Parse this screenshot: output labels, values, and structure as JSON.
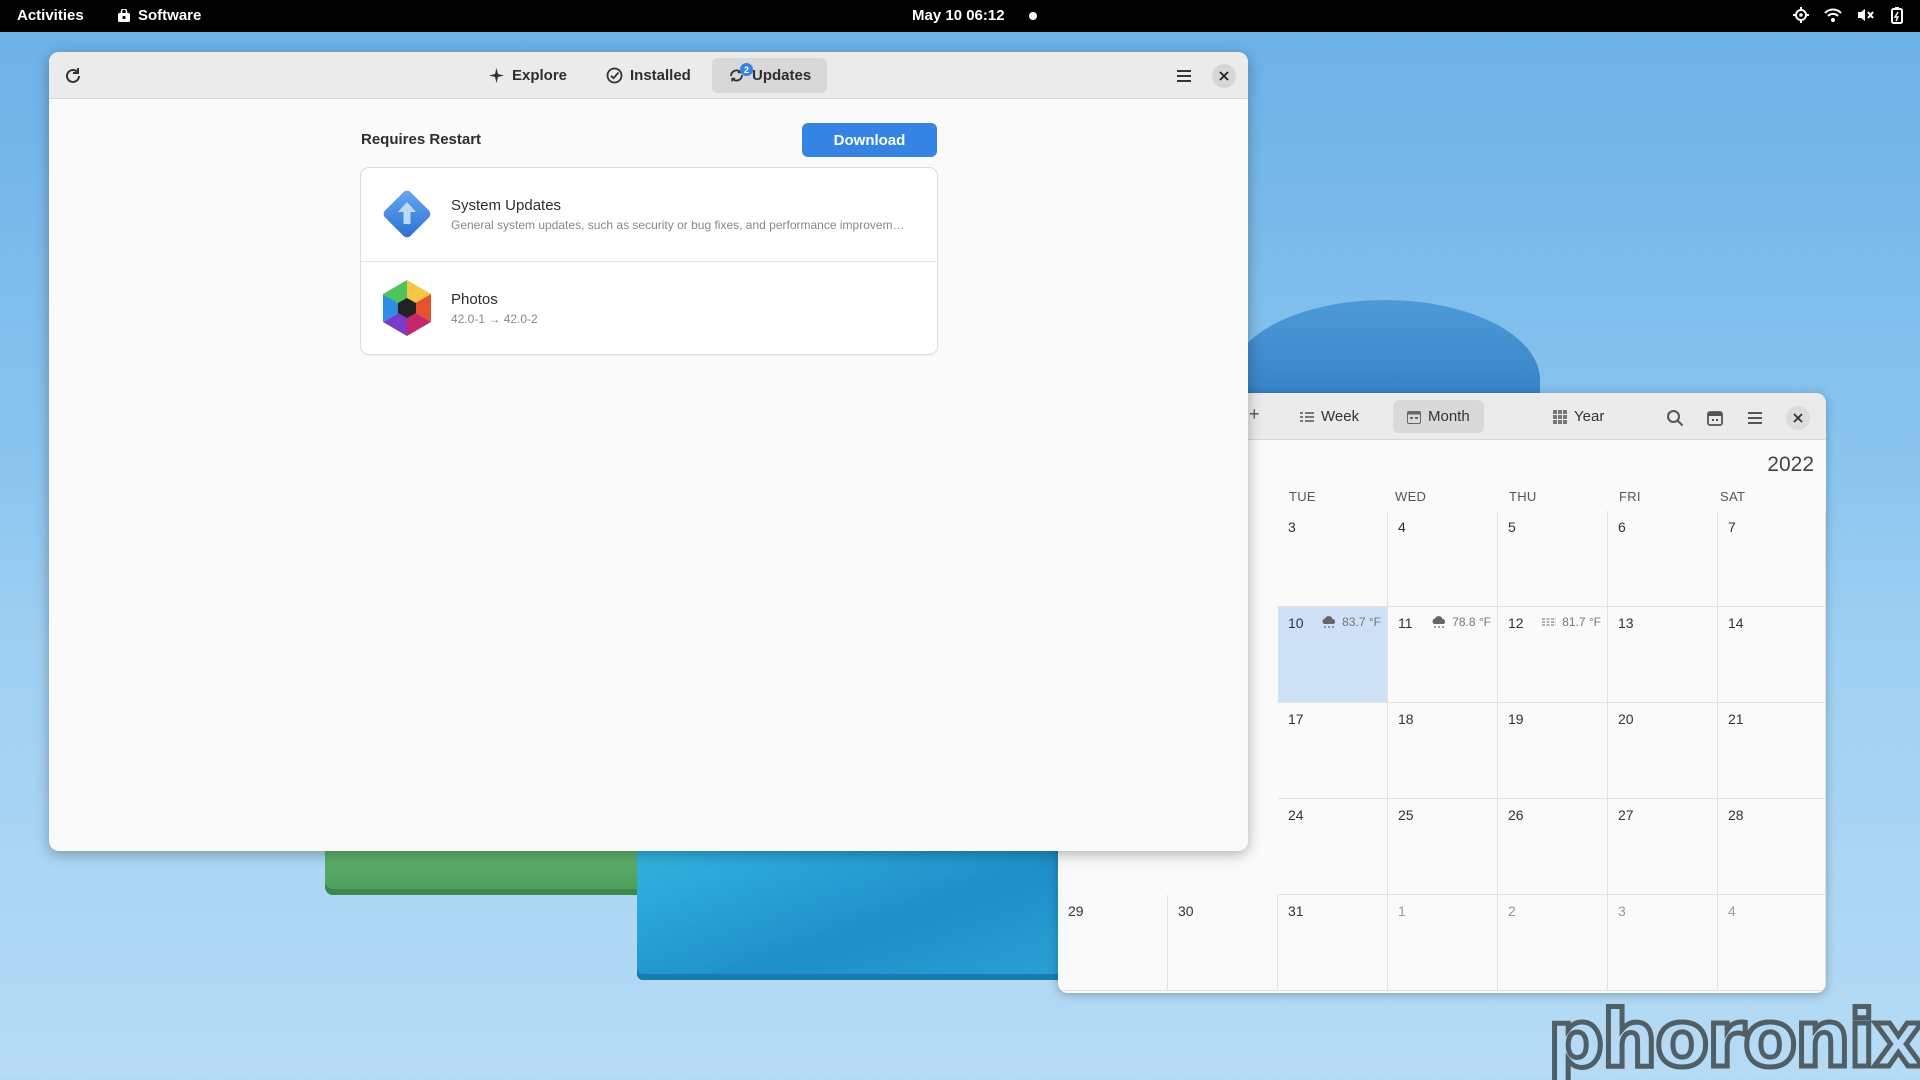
{
  "topbar": {
    "activities": "Activities",
    "app_name": "Software",
    "clock": "May 10  06:12",
    "tray_icons": [
      "location-icon",
      "wifi-icon",
      "volume-muted-icon",
      "battery-icon"
    ]
  },
  "software": {
    "tabs": [
      {
        "label": "Explore",
        "icon": "explore-icon"
      },
      {
        "label": "Installed",
        "icon": "installed-check-icon"
      },
      {
        "label": "Updates",
        "icon": "updates-icon",
        "badge": "2"
      }
    ],
    "active_tab": "Updates",
    "section_title": "Requires Restart",
    "download_label": "Download",
    "updates": [
      {
        "name": "System Updates",
        "detail": "General system updates, such as security or bug fixes, and performance improvements."
      },
      {
        "name": "Photos",
        "detail": "42.0-1 → 42.0-2"
      }
    ],
    "accent_color": "#3584e4"
  },
  "calendar": {
    "views": [
      "Week",
      "Month",
      "Year"
    ],
    "active_view": "Month",
    "year": "2022",
    "day_names": [
      "TUE",
      "WED",
      "THU",
      "FRI",
      "SAT"
    ],
    "weeks": [
      {
        "days": [
          "",
          "",
          "3",
          "4",
          "5",
          "6",
          "7"
        ]
      },
      {
        "days": [
          "",
          "",
          "10",
          "11",
          "12",
          "13",
          "14"
        ]
      },
      {
        "days": [
          "",
          "",
          "17",
          "18",
          "19",
          "20",
          "21"
        ]
      },
      {
        "days": [
          "",
          "",
          "24",
          "25",
          "26",
          "27",
          "28"
        ]
      },
      {
        "days": [
          "29",
          "30",
          "31",
          "1",
          "2",
          "3",
          "4"
        ]
      }
    ],
    "today": "10",
    "weather": [
      {
        "day": "10",
        "temp": "83.7 °F",
        "icon": "rain-cloud-icon"
      },
      {
        "day": "11",
        "temp": "78.8 °F",
        "icon": "rain-cloud-icon"
      },
      {
        "day": "12",
        "temp": "81.7 °F",
        "icon": "fog-icon"
      }
    ]
  },
  "watermark": "phoronix"
}
